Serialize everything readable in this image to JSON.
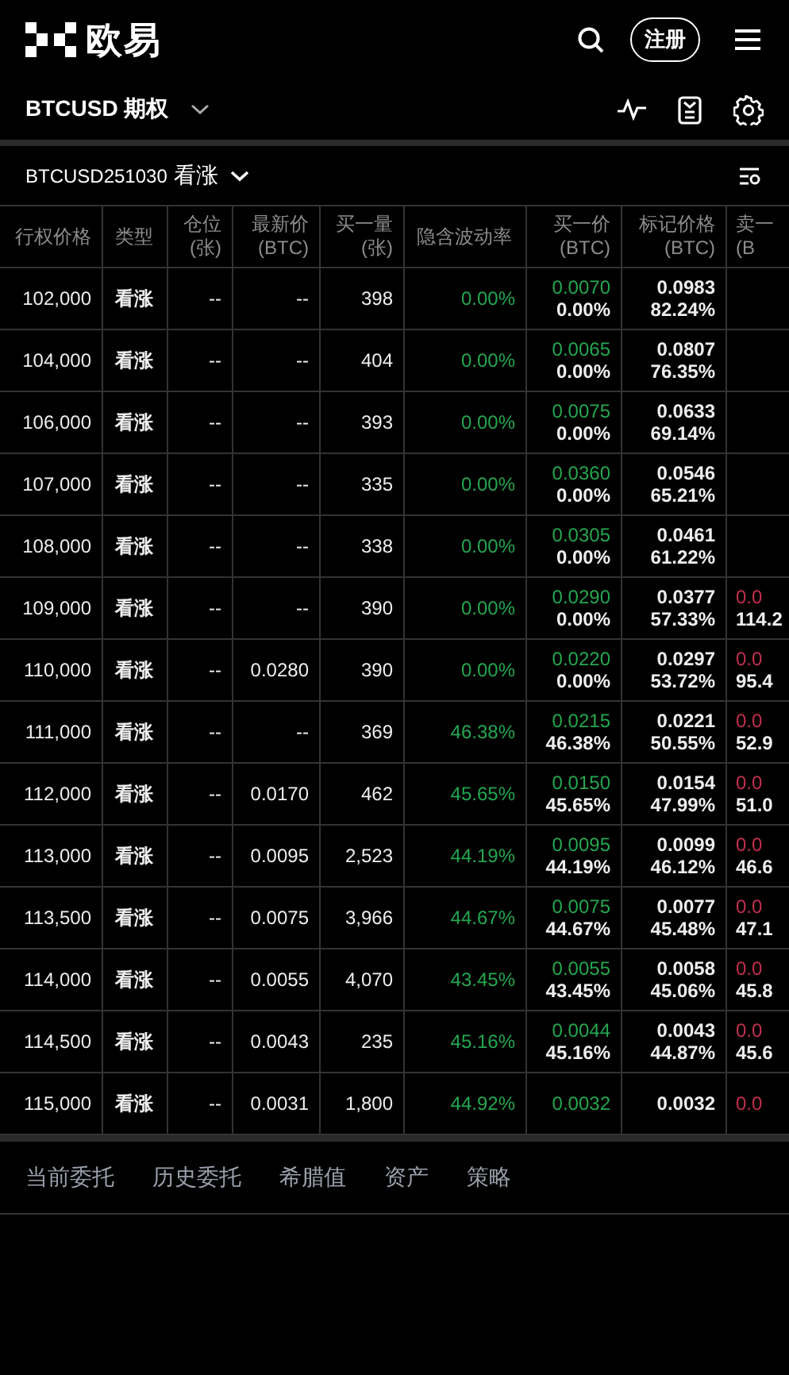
{
  "brand": {
    "name": "欧易"
  },
  "header": {
    "register_button": "注册"
  },
  "instrument_bar": {
    "title": "BTCUSD 期权"
  },
  "expiry_bar": {
    "expiry": "BTCUSD251030",
    "option_type": "看涨"
  },
  "table": {
    "columns": [
      {
        "label": "行权价格"
      },
      {
        "label": "类型"
      },
      {
        "label": "仓位",
        "unit": "(张)"
      },
      {
        "label": "最新价",
        "unit": "(BTC)"
      },
      {
        "label": "买一量",
        "unit": "(张)"
      },
      {
        "label": "隐含波动率"
      },
      {
        "label": "买一价",
        "unit": "(BTC)"
      },
      {
        "label": "标记价格",
        "unit": "(BTC)"
      },
      {
        "label": "卖一",
        "unit": "(B"
      }
    ],
    "rows": [
      {
        "strike": "102,000",
        "type": "看涨",
        "position": "--",
        "last": "--",
        "bid_qty": "398",
        "iv": "0.00%",
        "bid": "0.0070",
        "bid_iv": "0.00%",
        "mark": "0.0983",
        "mark_iv": "82.24%"
      },
      {
        "strike": "104,000",
        "type": "看涨",
        "position": "--",
        "last": "--",
        "bid_qty": "404",
        "iv": "0.00%",
        "bid": "0.0065",
        "bid_iv": "0.00%",
        "mark": "0.0807",
        "mark_iv": "76.35%"
      },
      {
        "strike": "106,000",
        "type": "看涨",
        "position": "--",
        "last": "--",
        "bid_qty": "393",
        "iv": "0.00%",
        "bid": "0.0075",
        "bid_iv": "0.00%",
        "mark": "0.0633",
        "mark_iv": "69.14%"
      },
      {
        "strike": "107,000",
        "type": "看涨",
        "position": "--",
        "last": "--",
        "bid_qty": "335",
        "iv": "0.00%",
        "bid": "0.0360",
        "bid_iv": "0.00%",
        "mark": "0.0546",
        "mark_iv": "65.21%"
      },
      {
        "strike": "108,000",
        "type": "看涨",
        "position": "--",
        "last": "--",
        "bid_qty": "338",
        "iv": "0.00%",
        "bid": "0.0305",
        "bid_iv": "0.00%",
        "mark": "0.0461",
        "mark_iv": "61.22%"
      },
      {
        "strike": "109,000",
        "type": "看涨",
        "position": "--",
        "last": "--",
        "bid_qty": "390",
        "iv": "0.00%",
        "bid": "0.0290",
        "bid_iv": "0.00%",
        "mark": "0.0377",
        "mark_iv": "57.33%",
        "ask": "0.0",
        "ask_iv": "114.2"
      },
      {
        "strike": "110,000",
        "type": "看涨",
        "position": "--",
        "last": "0.0280",
        "bid_qty": "390",
        "iv": "0.00%",
        "bid": "0.0220",
        "bid_iv": "0.00%",
        "mark": "0.0297",
        "mark_iv": "53.72%",
        "ask": "0.0",
        "ask_iv": "95.4"
      },
      {
        "strike": "111,000",
        "type": "看涨",
        "position": "--",
        "last": "--",
        "bid_qty": "369",
        "iv": "46.38%",
        "bid": "0.0215",
        "bid_iv": "46.38%",
        "mark": "0.0221",
        "mark_iv": "50.55%",
        "ask": "0.0",
        "ask_iv": "52.9"
      },
      {
        "strike": "112,000",
        "type": "看涨",
        "position": "--",
        "last": "0.0170",
        "bid_qty": "462",
        "iv": "45.65%",
        "bid": "0.0150",
        "bid_iv": "45.65%",
        "mark": "0.0154",
        "mark_iv": "47.99%",
        "ask": "0.0",
        "ask_iv": "51.0"
      },
      {
        "strike": "113,000",
        "type": "看涨",
        "position": "--",
        "last": "0.0095",
        "bid_qty": "2,523",
        "iv": "44.19%",
        "bid": "0.0095",
        "bid_iv": "44.19%",
        "mark": "0.0099",
        "mark_iv": "46.12%",
        "ask": "0.0",
        "ask_iv": "46.6"
      },
      {
        "strike": "113,500",
        "type": "看涨",
        "position": "--",
        "last": "0.0075",
        "bid_qty": "3,966",
        "iv": "44.67%",
        "bid": "0.0075",
        "bid_iv": "44.67%",
        "mark": "0.0077",
        "mark_iv": "45.48%",
        "ask": "0.0",
        "ask_iv": "47.1"
      },
      {
        "strike": "114,000",
        "type": "看涨",
        "position": "--",
        "last": "0.0055",
        "bid_qty": "4,070",
        "iv": "43.45%",
        "bid": "0.0055",
        "bid_iv": "43.45%",
        "mark": "0.0058",
        "mark_iv": "45.06%",
        "ask": "0.0",
        "ask_iv": "45.8"
      },
      {
        "strike": "114,500",
        "type": "看涨",
        "position": "--",
        "last": "0.0043",
        "bid_qty": "235",
        "iv": "45.16%",
        "bid": "0.0044",
        "bid_iv": "45.16%",
        "mark": "0.0043",
        "mark_iv": "44.87%",
        "ask": "0.0",
        "ask_iv": "45.6"
      },
      {
        "strike": "115,000",
        "type": "看涨",
        "position": "--",
        "last": "0.0031",
        "bid_qty": "1,800",
        "iv": "44.92%",
        "bid": "0.0032",
        "mark": "0.0032",
        "ask": "0.0"
      }
    ]
  },
  "bottom_tabs": [
    "当前委托",
    "历史委托",
    "希腊值",
    "资产",
    "策略"
  ]
}
